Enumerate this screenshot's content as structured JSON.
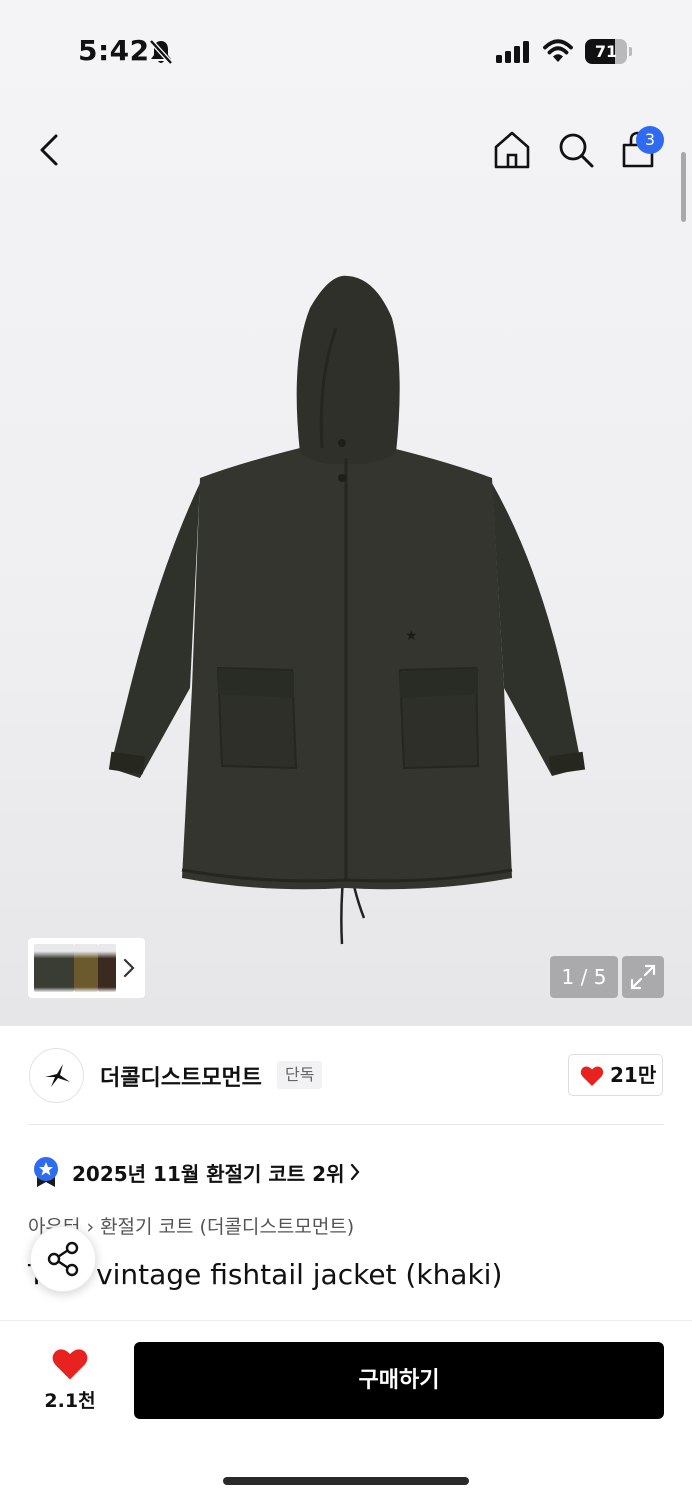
{
  "status_bar": {
    "time": "5:42",
    "battery_level": "71",
    "battery_fraction": 0.71
  },
  "nav": {
    "cart_count": "3"
  },
  "gallery": {
    "pager": "1 / 5",
    "thumb_colors": [
      "#3a3d33",
      "#6b5a2e",
      "#3b2a20"
    ]
  },
  "brand": {
    "name": "더콜디스트모먼트",
    "exclusive_tag": "단독",
    "likes": "21만"
  },
  "ranking": {
    "text": "2025년 11월 환절기 코트 2위"
  },
  "breadcrumb": {
    "category": "아우터",
    "subcategory": "환절기 코트 (더콜디스트모먼트)"
  },
  "product": {
    "title": "TCM vintage fishtail jacket (khaki)"
  },
  "bottom_bar": {
    "wish_count": "2.1천",
    "buy_label": "구매하기"
  },
  "colors": {
    "accent_blue": "#2f6bf2",
    "heart_red": "#e8221f",
    "jacket": "#33352e"
  }
}
